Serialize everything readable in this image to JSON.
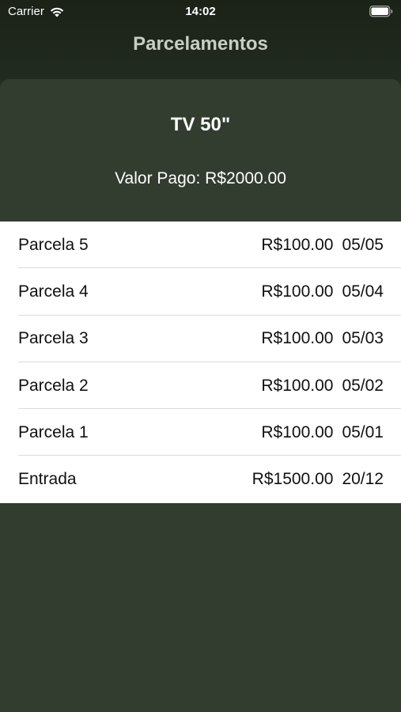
{
  "status_bar": {
    "carrier": "Carrier",
    "time": "14:02"
  },
  "nav": {
    "title": "Parcelamentos"
  },
  "product": {
    "title": "TV 50\"",
    "paid_value": "Valor Pago: R$2000.00"
  },
  "installments": [
    {
      "label": "Parcela 5",
      "amount": "R$100.00",
      "date": "05/05"
    },
    {
      "label": "Parcela 4",
      "amount": "R$100.00",
      "date": "05/04"
    },
    {
      "label": "Parcela 3",
      "amount": "R$100.00",
      "date": "05/03"
    },
    {
      "label": "Parcela 2",
      "amount": "R$100.00",
      "date": "05/02"
    },
    {
      "label": "Parcela 1",
      "amount": "R$100.00",
      "date": "05/01"
    },
    {
      "label": "Entrada",
      "amount": "R$1500.00",
      "date": "20/12"
    }
  ],
  "colors": {
    "background": "#2c3629",
    "sheet": "#323d2f",
    "list_background": "#ffffff"
  }
}
